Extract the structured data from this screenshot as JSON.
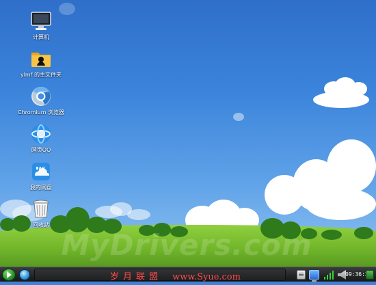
{
  "desktop_icons": [
    {
      "label": "计算机",
      "icon": "computer-icon"
    },
    {
      "label": "ylmf 的主文件夹",
      "icon": "home-folder-icon"
    },
    {
      "label": "Chromium 浏览器",
      "icon": "chromium-browser-icon"
    },
    {
      "label": "网页QQ",
      "icon": "web-qq-icon"
    },
    {
      "label": "我的网盘",
      "icon": "cloud-drive-icon"
    },
    {
      "label": "回收站",
      "icon": "trash-icon"
    }
  ],
  "watermark": {
    "text": "MyDrivers.com"
  },
  "overlay": {
    "brand": "岁月联盟",
    "site": "www.Syue.com"
  },
  "taskbar": {
    "start_icon": "start-menu-icon",
    "quicklaunch_icon": "browser-icon",
    "clock": "09:36:37",
    "tray_icons": [
      "keyboard-icon",
      "monitor-icon",
      "network-icon",
      "volume-icon",
      "show-desktop-icon"
    ]
  },
  "colors": {
    "sky_top": "#2f6fc9",
    "sky_bottom": "#8fc3f1",
    "grass": "#71b52a",
    "taskbar": "#232425",
    "overlay_red": "#ff4b4b"
  }
}
